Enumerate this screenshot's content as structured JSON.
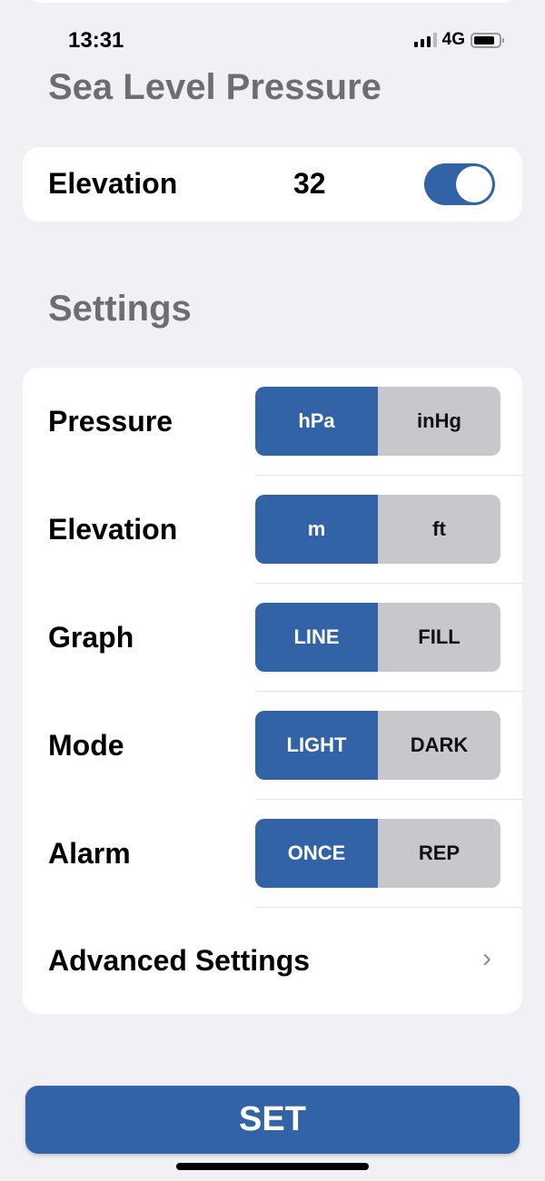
{
  "status": {
    "time": "13:31",
    "network": "4G"
  },
  "title": "Sea Level Pressure",
  "elevation_card": {
    "label": "Elevation",
    "value": "32",
    "toggle_on": true
  },
  "settings": {
    "heading": "Settings",
    "rows": [
      {
        "label": "Pressure",
        "options": [
          "hPa",
          "inHg"
        ],
        "selected": "hPa"
      },
      {
        "label": "Elevation",
        "options": [
          "m",
          "ft"
        ],
        "selected": "m"
      },
      {
        "label": "Graph",
        "options": [
          "LINE",
          "FILL"
        ],
        "selected": "LINE"
      },
      {
        "label": "Mode",
        "options": [
          "LIGHT",
          "DARK"
        ],
        "selected": "LIGHT"
      },
      {
        "label": "Alarm",
        "options": [
          "ONCE",
          "REP"
        ],
        "selected": "ONCE"
      }
    ],
    "advanced": "Advanced Settings"
  },
  "set_button": "SET",
  "colors": {
    "accent": "#3163a6",
    "segment_off": "#c8c8cc",
    "background": "#f0f0f5"
  }
}
